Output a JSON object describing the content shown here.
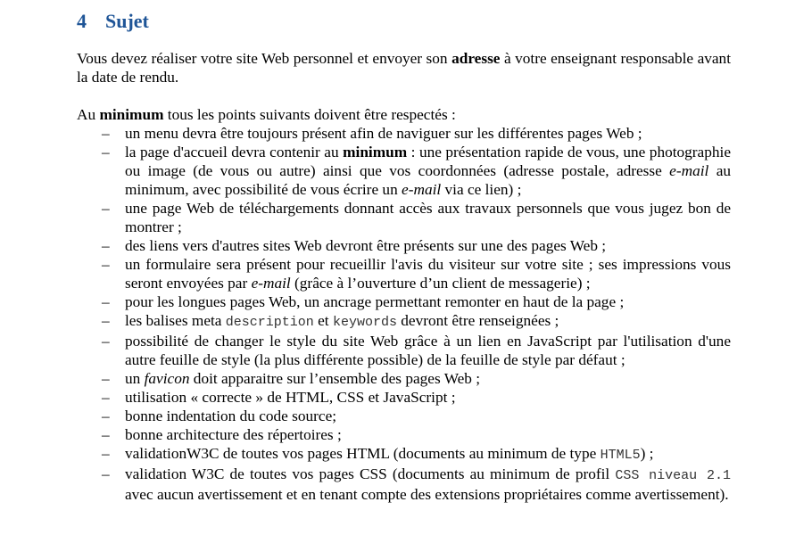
{
  "section": {
    "number": "4",
    "title": "Sujet"
  },
  "intro": {
    "part1": "Vous devez réaliser votre site Web personnel et envoyer son ",
    "bold": "adresse",
    "part2": " à votre enseignant responsable avant la date de rendu."
  },
  "lead": {
    "part1": "Au ",
    "bold": "minimum",
    "part2": " tous les points suivants doivent être respectés :"
  },
  "bullet_glyph": "–",
  "items": {
    "menu": "un menu devra être toujours présent afin de naviguer sur les différentes pages Web ;",
    "accueil": {
      "part1": "la page d'accueil devra contenir au ",
      "bold": "minimum",
      "part2": " : une présentation rapide de vous, une photographie ou image (de vous ou autre) ainsi que vos coordonnées (adresse postale, adresse ",
      "italic1": "e-mail",
      "part3": " au minimum, avec possibilité de vous écrire un ",
      "italic2": "e-mail",
      "part4": " via ce lien) ;"
    },
    "telechargements": "une page Web de téléchargements donnant accès aux travaux personnels que vous jugez bon de montrer ;",
    "liens": "des liens vers d'autres sites Web devront être présents sur une des pages Web ;",
    "formulaire": {
      "part1": "un formulaire sera présent pour recueillir l'avis du visiteur sur votre site ; ses impressions vous seront envoyées par ",
      "italic": "e-mail",
      "part2": " (grâce à l’ouverture d’un client de messagerie) ;"
    },
    "ancrage": "pour les longues pages Web, un ancrage permettant remonter en haut de la page ;",
    "meta": {
      "part1": "les balises meta ",
      "code1": "description",
      "part2": " et ",
      "code2": "keywords",
      "part3": " devront être renseignées ;"
    },
    "style": "possibilité de changer le style du site Web grâce à un lien en JavaScript par l'utilisation d'une autre feuille de style (la plus différente possible) de la feuille de style par défaut ;",
    "favicon": {
      "part1": "un ",
      "italic": "favicon",
      "part2": " doit apparaitre sur l’ensemble des pages Web ;"
    },
    "utilisation": "utilisation « correcte » de HTML, CSS et JavaScript ;",
    "indentation": "bonne indentation du code source;",
    "architecture": "bonne architecture des répertoires ;",
    "validation_html": {
      "part1": "validationW3C de toutes vos pages HTML (documents au minimum de type ",
      "code": "HTML5",
      "part2": ") ;"
    },
    "validation_css": {
      "part1": "validation W3C de toutes vos pages CSS (documents au minimum de profil ",
      "code": "CSS niveau 2.1",
      "part2": " avec aucun avertissement et en tenant compte des extensions propriétaires comme avertissement)."
    }
  }
}
